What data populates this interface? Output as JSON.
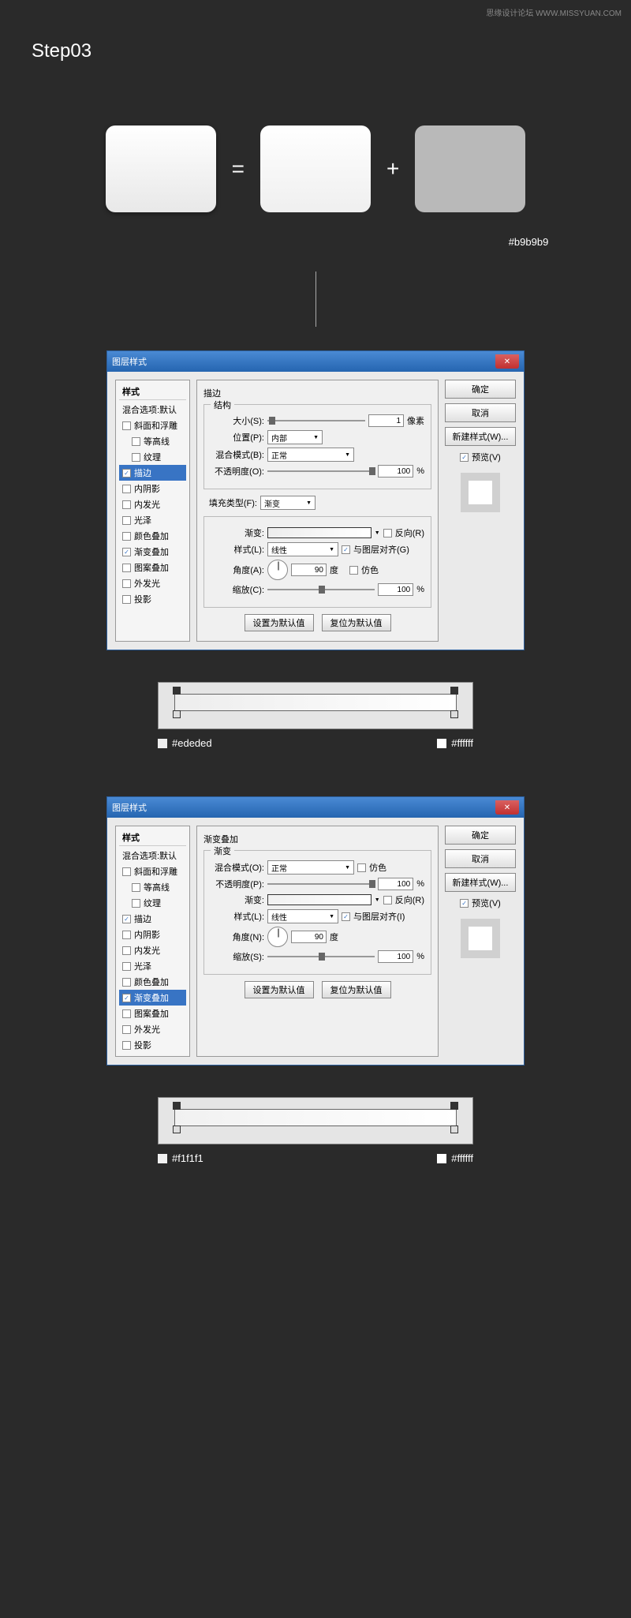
{
  "header": {
    "left": "思缘设计论坛",
    "right": "WWW.MISSYUAN.COM"
  },
  "step": "Step03",
  "shapes": {
    "eq": "=",
    "plus": "+",
    "gray_hex": "#b9b9b9"
  },
  "dialog1": {
    "title": "图层样式",
    "styles_title": "样式",
    "blend_defaults": "混合选项:默认",
    "items": [
      {
        "label": "斜面和浮雕",
        "checked": false,
        "selected": false
      },
      {
        "label": "等高线",
        "checked": false,
        "selected": false,
        "indent": true
      },
      {
        "label": "纹理",
        "checked": false,
        "selected": false,
        "indent": true
      },
      {
        "label": "描边",
        "checked": true,
        "selected": true
      },
      {
        "label": "内阴影",
        "checked": false,
        "selected": false
      },
      {
        "label": "内发光",
        "checked": false,
        "selected": false
      },
      {
        "label": "光泽",
        "checked": false,
        "selected": false
      },
      {
        "label": "颜色叠加",
        "checked": false,
        "selected": false
      },
      {
        "label": "渐变叠加",
        "checked": true,
        "selected": false
      },
      {
        "label": "图案叠加",
        "checked": false,
        "selected": false
      },
      {
        "label": "外发光",
        "checked": false,
        "selected": false
      },
      {
        "label": "投影",
        "checked": false,
        "selected": false
      }
    ],
    "section_title": "描边",
    "struct_title": "结构",
    "size_label": "大小(S):",
    "size_val": "1",
    "size_unit": "像素",
    "pos_label": "位置(P):",
    "pos_val": "内部",
    "blend_label": "混合模式(B):",
    "blend_val": "正常",
    "opacity_label": "不透明度(O):",
    "opacity_val": "100",
    "opacity_unit": "%",
    "fill_label": "填充类型(F):",
    "fill_val": "渐变",
    "grad_label": "渐变:",
    "reverse_label": "反向(R)",
    "style_label": "样式(L):",
    "style_val": "线性",
    "align_label": "与图层对齐(G)",
    "angle_label": "角度(A):",
    "angle_val": "90",
    "angle_unit": "度",
    "dither_label": "仿色",
    "scale_label": "缩放(C):",
    "scale_val": "100",
    "scale_unit": "%",
    "btn_default": "设置为默认值",
    "btn_reset": "复位为默认值",
    "ok": "确定",
    "cancel": "取消",
    "new_style": "新建样式(W)...",
    "preview": "预览(V)"
  },
  "grad1": {
    "left": "#ededed",
    "right": "#ffffff"
  },
  "dialog2": {
    "title": "图层样式",
    "styles_title": "样式",
    "blend_defaults": "混合选项:默认",
    "items": [
      {
        "label": "斜面和浮雕",
        "checked": false,
        "selected": false
      },
      {
        "label": "等高线",
        "checked": false,
        "selected": false,
        "indent": true
      },
      {
        "label": "纹理",
        "checked": false,
        "selected": false,
        "indent": true
      },
      {
        "label": "描边",
        "checked": true,
        "selected": false
      },
      {
        "label": "内阴影",
        "checked": false,
        "selected": false
      },
      {
        "label": "内发光",
        "checked": false,
        "selected": false
      },
      {
        "label": "光泽",
        "checked": false,
        "selected": false
      },
      {
        "label": "颜色叠加",
        "checked": false,
        "selected": false
      },
      {
        "label": "渐变叠加",
        "checked": true,
        "selected": true
      },
      {
        "label": "图案叠加",
        "checked": false,
        "selected": false
      },
      {
        "label": "外发光",
        "checked": false,
        "selected": false
      },
      {
        "label": "投影",
        "checked": false,
        "selected": false
      }
    ],
    "section_title": "渐变叠加",
    "grad_title": "渐变",
    "blend_label": "混合模式(O):",
    "blend_val": "正常",
    "dither_label": "仿色",
    "opacity_label": "不透明度(P):",
    "opacity_val": "100",
    "opacity_unit": "%",
    "grad_label": "渐变:",
    "reverse_label": "反向(R)",
    "style_label": "样式(L):",
    "style_val": "线性",
    "align_label": "与图层对齐(I)",
    "angle_label": "角度(N):",
    "angle_val": "90",
    "angle_unit": "度",
    "scale_label": "缩放(S):",
    "scale_val": "100",
    "scale_unit": "%",
    "btn_default": "设置为默认值",
    "btn_reset": "复位为默认值",
    "ok": "确定",
    "cancel": "取消",
    "new_style": "新建样式(W)...",
    "preview": "预览(V)"
  },
  "grad2": {
    "left": "#f1f1f1",
    "right": "#ffffff"
  }
}
